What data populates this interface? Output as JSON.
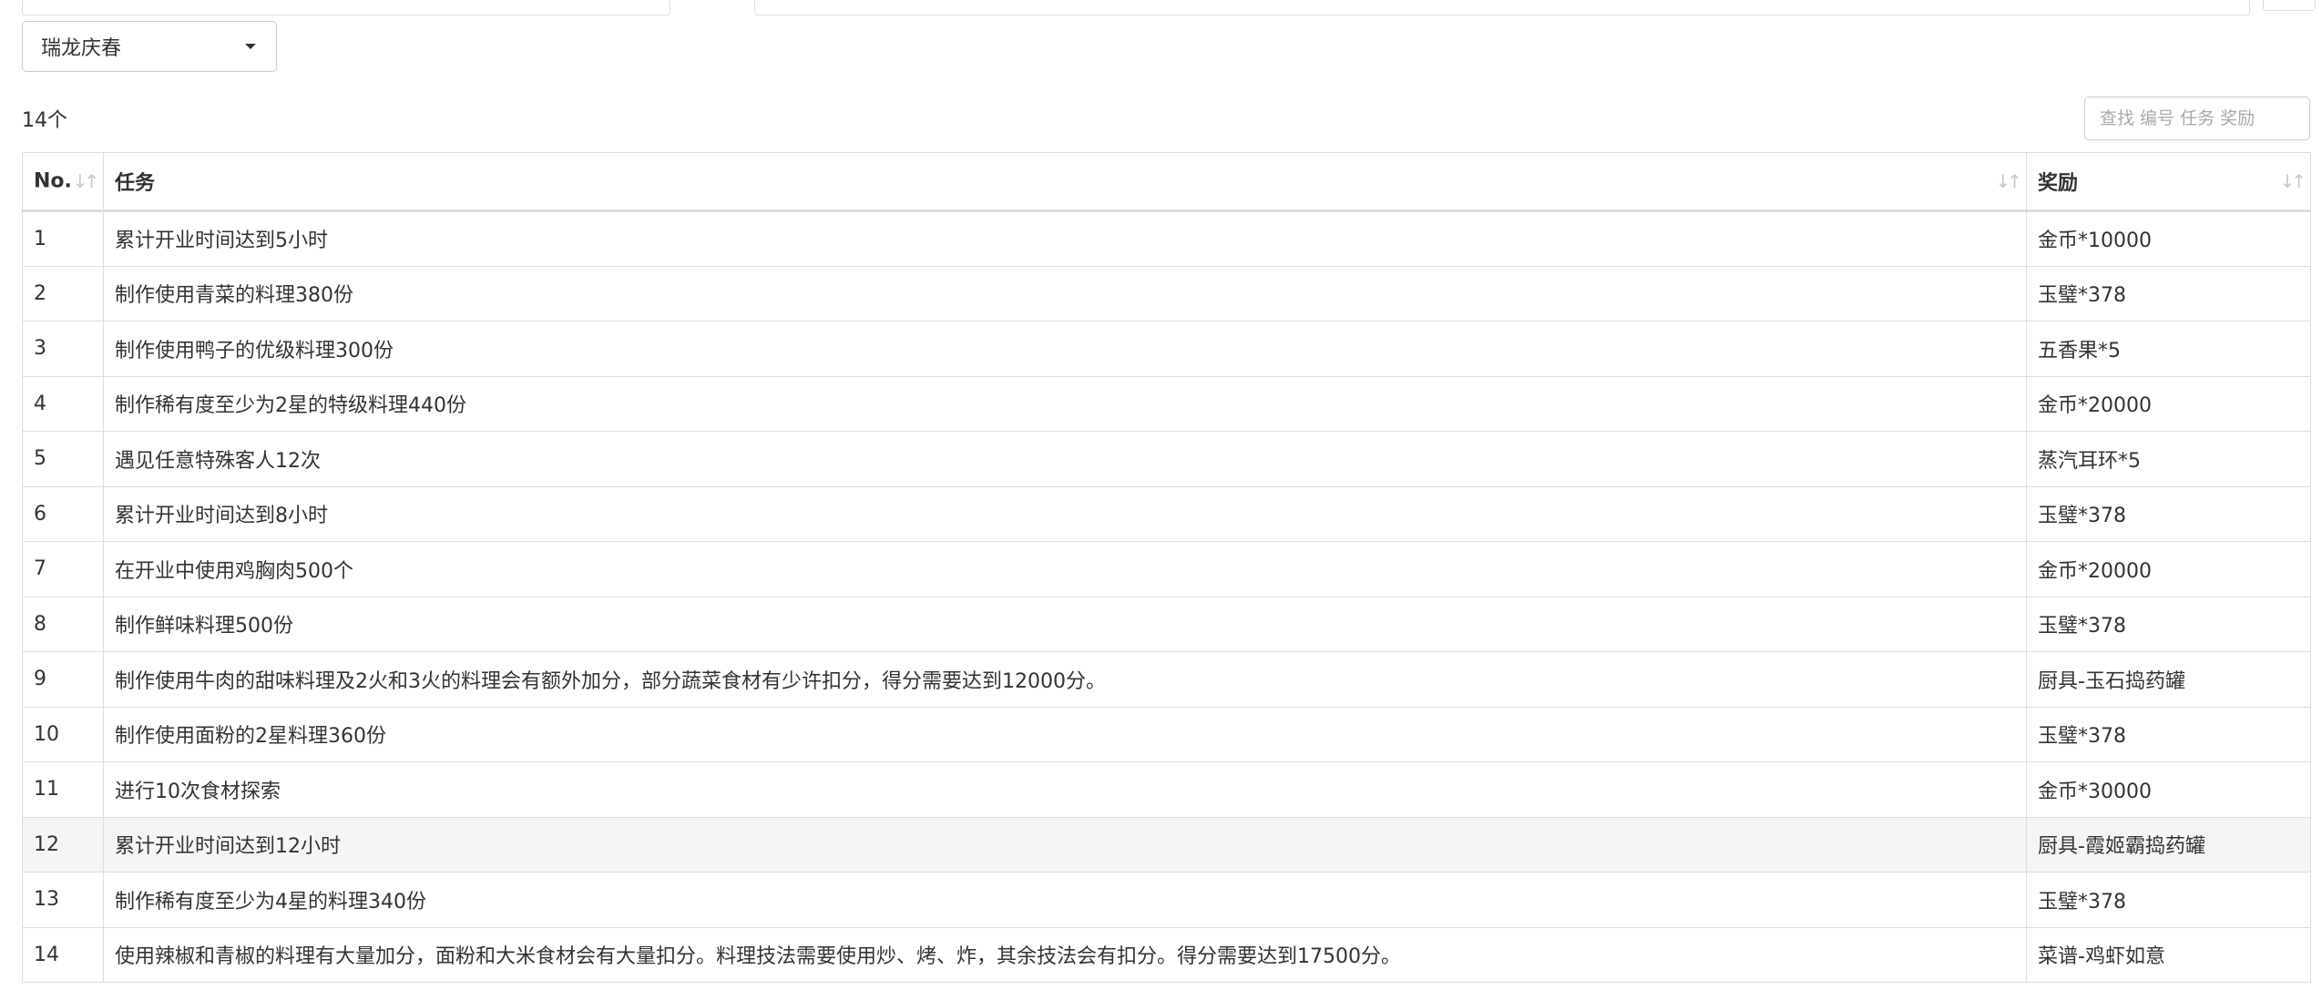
{
  "filter": {
    "selected": "瑞龙庆春"
  },
  "count_label": "14个",
  "search": {
    "placeholder": "查找 编号 任务 奖励"
  },
  "table": {
    "headers": {
      "no": "No.",
      "task": "任务",
      "reward": "奖励"
    },
    "rows": [
      {
        "no": "1",
        "task": "累计开业时间达到5小时",
        "reward": "金币*10000"
      },
      {
        "no": "2",
        "task": "制作使用青菜的料理380份",
        "reward": "玉璧*378"
      },
      {
        "no": "3",
        "task": "制作使用鸭子的优级料理300份",
        "reward": "五香果*5"
      },
      {
        "no": "4",
        "task": "制作稀有度至少为2星的特级料理440份",
        "reward": "金币*20000"
      },
      {
        "no": "5",
        "task": "遇见任意特殊客人12次",
        "reward": "蒸汽耳环*5"
      },
      {
        "no": "6",
        "task": "累计开业时间达到8小时",
        "reward": "玉璧*378"
      },
      {
        "no": "7",
        "task": "在开业中使用鸡胸肉500个",
        "reward": "金币*20000"
      },
      {
        "no": "8",
        "task": "制作鲜味料理500份",
        "reward": "玉璧*378"
      },
      {
        "no": "9",
        "task": "制作使用牛肉的甜味料理及2火和3火的料理会有额外加分，部分蔬菜食材有少许扣分，得分需要达到12000分。",
        "reward": "厨具-玉石捣药罐"
      },
      {
        "no": "10",
        "task": "制作使用面粉的2星料理360份",
        "reward": "玉璧*378"
      },
      {
        "no": "11",
        "task": "进行10次食材探索",
        "reward": "金币*30000"
      },
      {
        "no": "12",
        "task": "累计开业时间达到12小时",
        "reward": "厨具-霞姬霸捣药罐",
        "highlight": true
      },
      {
        "no": "13",
        "task": "制作稀有度至少为4星的料理340份",
        "reward": "玉璧*378"
      },
      {
        "no": "14",
        "task": "使用辣椒和青椒的料理有大量加分，面粉和大米食材会有大量扣分。料理技法需要使用炒、烤、炸，其余技法会有扣分。得分需要达到17500分。",
        "reward": "菜谱-鸡虾如意"
      }
    ]
  }
}
